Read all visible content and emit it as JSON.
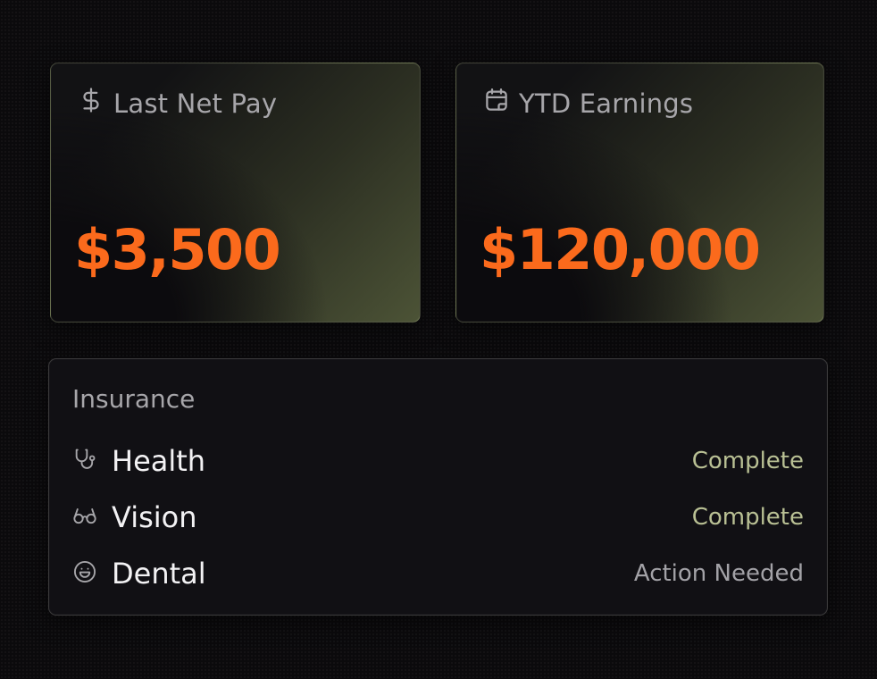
{
  "cards": {
    "net_pay": {
      "icon": "dollar-icon",
      "label": "Last Net Pay",
      "value": "$3,500"
    },
    "ytd": {
      "icon": "calendar-icon",
      "label": "YTD Earnings",
      "value": "$120,000"
    }
  },
  "insurance": {
    "title": "Insurance",
    "items": [
      {
        "icon": "stethoscope-icon",
        "name": "Health",
        "status": "Complete"
      },
      {
        "icon": "glasses-icon",
        "name": "Vision",
        "status": "Complete"
      },
      {
        "icon": "smile-icon",
        "name": "Dental",
        "status": "Action Needed"
      }
    ]
  },
  "colors": {
    "accent": "#fb6a1c",
    "status_complete": "#b9c094",
    "status_action": "#a3a2a7",
    "background": "#0b0a0c"
  }
}
